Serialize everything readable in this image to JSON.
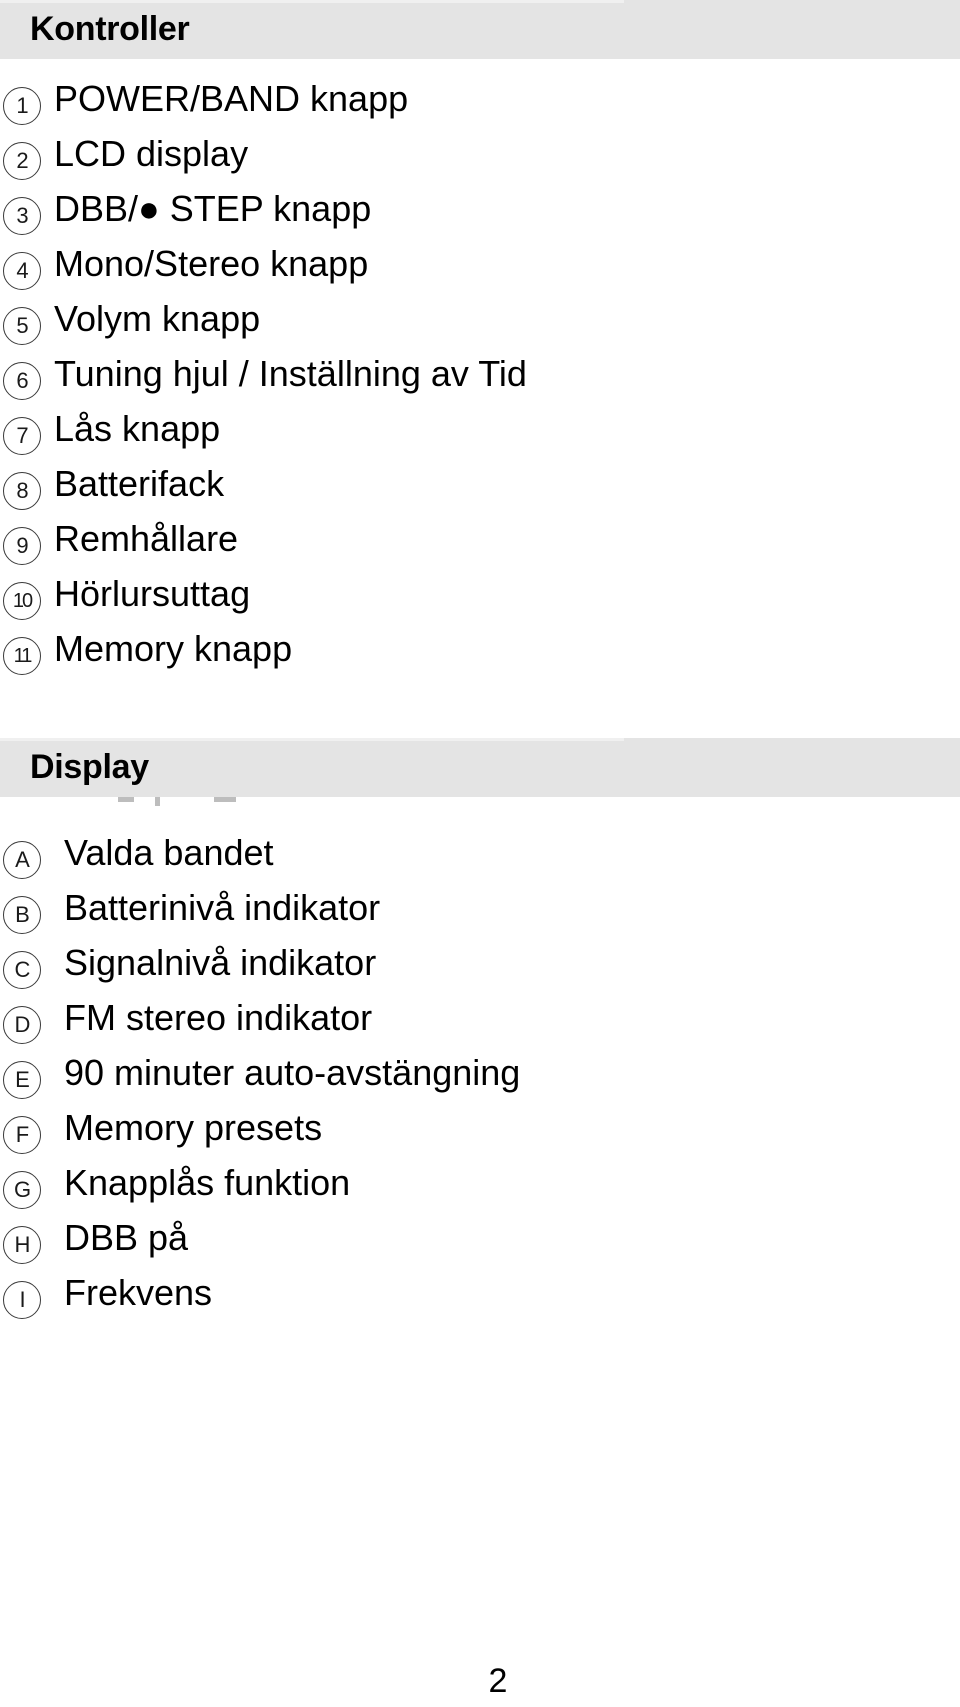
{
  "document": {
    "page_number": "2"
  },
  "sections": [
    {
      "id": "controls",
      "heading": "Kontroller",
      "items": [
        {
          "marker": "1",
          "label": "POWER/BAND knapp"
        },
        {
          "marker": "2",
          "label": "LCD display"
        },
        {
          "marker": "3",
          "label": "DBB/● STEP knapp"
        },
        {
          "marker": "4",
          "label": "Mono/Stereo knapp"
        },
        {
          "marker": "5",
          "label": "Volym knapp"
        },
        {
          "marker": "6",
          "label": "Tuning hjul / Inställning av Tid"
        },
        {
          "marker": "7",
          "label": "Lås knapp"
        },
        {
          "marker": "8",
          "label": "Batterifack"
        },
        {
          "marker": "9",
          "label": "Remhållare"
        },
        {
          "marker": "10",
          "label": "Hörlursuttag"
        },
        {
          "marker": "11",
          "label": "Memory knapp"
        }
      ]
    },
    {
      "id": "display",
      "heading": "Display",
      "items": [
        {
          "marker": "A",
          "label": "Valda bandet"
        },
        {
          "marker": "B",
          "label": "Batterinivå indikator"
        },
        {
          "marker": "C",
          "label": "Signalnivå indikator"
        },
        {
          "marker": "D",
          "label": "FM stereo indikator"
        },
        {
          "marker": "E",
          "label": "90 minuter auto-avstängning"
        },
        {
          "marker": "F",
          "label": "Memory presets"
        },
        {
          "marker": "G",
          "label": "Knapplås funktion"
        },
        {
          "marker": "H",
          "label": "DBB på"
        },
        {
          "marker": "I",
          "label": "Frekvens"
        }
      ]
    }
  ],
  "colors": {
    "band_background": "#e4e4e4",
    "band_highlight": "#f0f0f0",
    "text": "#000000",
    "marker_outline": "#3a3a3a"
  }
}
